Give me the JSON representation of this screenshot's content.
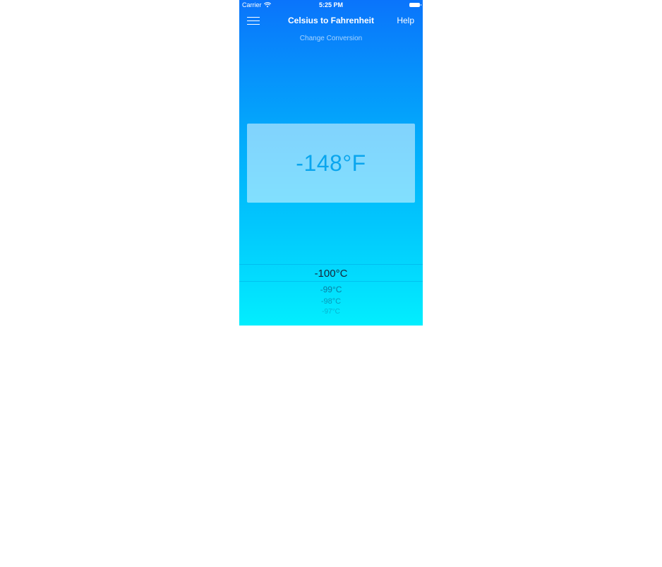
{
  "status_bar": {
    "carrier": "Carrier",
    "time": "5:25 PM",
    "wifi_icon": "wifi-icon",
    "battery_icon": "battery-full-icon"
  },
  "nav": {
    "menu_icon": "hamburger-menu-icon",
    "title": "Celsius to Fahrenheit",
    "help_label": "Help"
  },
  "change_conversion_label": "Change Conversion",
  "result": {
    "value": "-148°F"
  },
  "picker": {
    "selected": "-100°C",
    "items": [
      "-99°C",
      "-98°C",
      "-97°C"
    ]
  },
  "colors": {
    "gradient_top": "#0a74fb",
    "gradient_bottom": "#02eefe",
    "result_text": "#0aa6ee"
  }
}
